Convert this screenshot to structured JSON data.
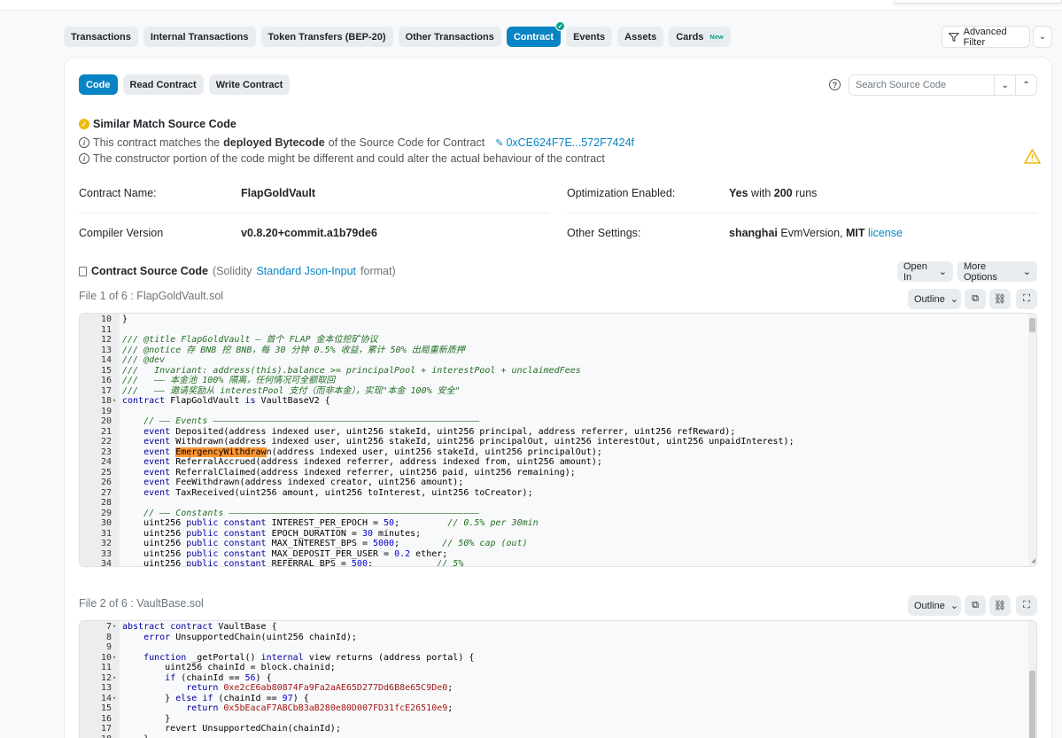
{
  "tabs": [
    {
      "label": "Transactions"
    },
    {
      "label": "Internal Transactions"
    },
    {
      "label": "Token Transfers (BEP-20)"
    },
    {
      "label": "Other Transactions"
    },
    {
      "label": "Contract"
    },
    {
      "label": "Events"
    },
    {
      "label": "Assets"
    },
    {
      "label": "Cards",
      "badge": "New"
    }
  ],
  "advanced_filter": "Advanced Filter",
  "subtabs": [
    {
      "label": "Code"
    },
    {
      "label": "Read Contract"
    },
    {
      "label": "Write Contract"
    }
  ],
  "search": {
    "placeholder": "Search Source Code"
  },
  "match": {
    "title": "Similar Match Source Code",
    "line1_prefix": "This contract matches the",
    "line1_bold": "deployed Bytecode",
    "line1_suffix": "of the Source Code for Contract",
    "address": "0xCE624F7E...572F7424f",
    "line2": "The constructor portion of the code might be different and could alter the actual behaviour of the contract"
  },
  "details": {
    "contract_name_label": "Contract Name:",
    "contract_name": "FlapGoldVault",
    "compiler_label": "Compiler Version",
    "compiler": "v0.8.20+commit.a1b79de6",
    "optimization_label": "Optimization Enabled:",
    "optimization_yes": "Yes",
    "optimization_with": "with",
    "optimization_runs": "200",
    "optimization_runs_suffix": "runs",
    "other_label": "Other Settings:",
    "other_evm": "shanghai",
    "other_evm_suffix": "EvmVersion,",
    "other_license": "MIT",
    "other_license_link": "license"
  },
  "source": {
    "title": "Contract Source Code",
    "paren_open": "(Solidity",
    "link": "Standard Json-Input",
    "paren_close": "format)",
    "open_in": "Open In",
    "more_options": "More Options"
  },
  "files": [
    {
      "label": "File 1 of 6 : FlapGoldVault.sol",
      "outline": "Outline"
    },
    {
      "label": "File 2 of 6 : VaultBase.sol",
      "outline": "Outline"
    }
  ]
}
